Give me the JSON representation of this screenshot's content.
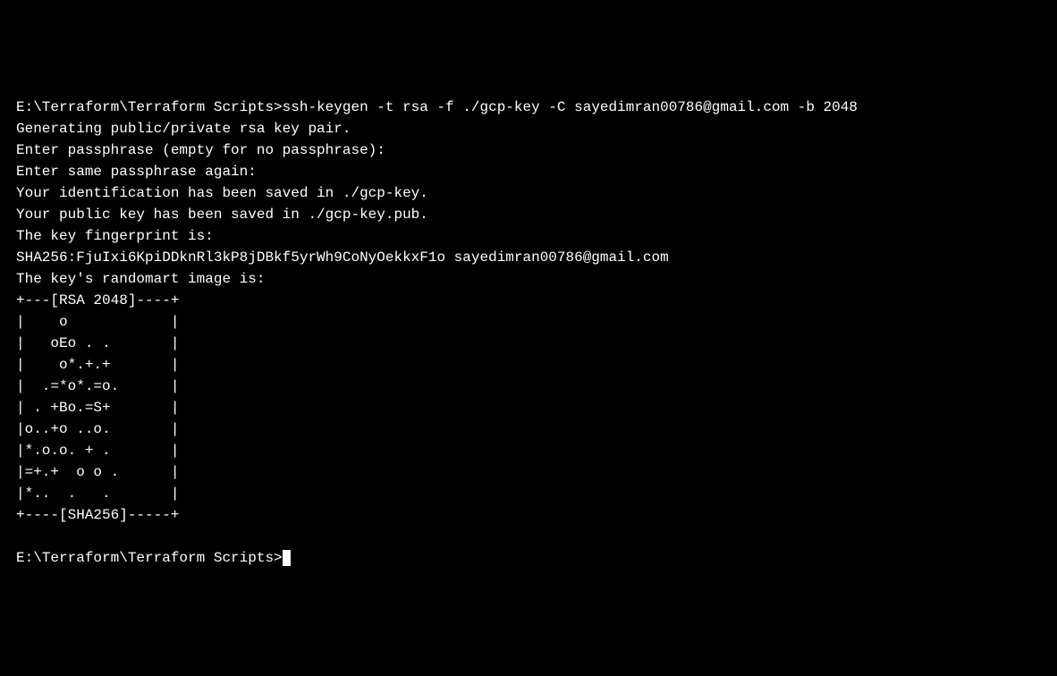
{
  "terminal": {
    "prompt1": "E:\\Terraform\\Terraform Scripts>",
    "command": "ssh-keygen -t rsa -f ./gcp-key -C sayedimran00786@gmail.com -b 2048",
    "lines": [
      "Generating public/private rsa key pair.",
      "Enter passphrase (empty for no passphrase):",
      "Enter same passphrase again:",
      "Your identification has been saved in ./gcp-key.",
      "Your public key has been saved in ./gcp-key.pub.",
      "The key fingerprint is:",
      "SHA256:FjuIxi6KpiDDknRl3kP8jDBkf5yrWh9CoNyOekkxF1o sayedimran00786@gmail.com",
      "The key's randomart image is:",
      "+---[RSA 2048]----+",
      "|    o            |",
      "|   oEo . .       |",
      "|    o*.+.+       |",
      "|  .=*o*.=o.      |",
      "| . +Bo.=S+       |",
      "|o..+o ..o.       |",
      "|*.o.o. + .       |",
      "|=+.+  o o .      |",
      "|*..  .   .       |",
      "+----[SHA256]-----+",
      ""
    ],
    "prompt2": "E:\\Terraform\\Terraform Scripts>"
  }
}
